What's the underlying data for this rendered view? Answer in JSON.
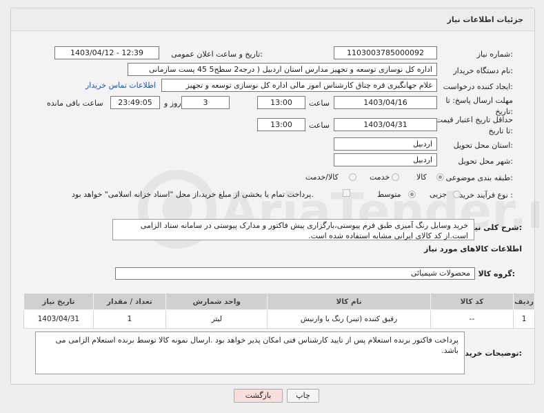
{
  "header": {
    "title": "جزئیات اطلاعات نیاز"
  },
  "fields": {
    "need_number_label": "شماره نیاز:",
    "need_number": "1103003785000092",
    "announce_label": "تاریخ و ساعت اعلان عمومی:",
    "announce_value": "1403/04/12 - 12:39",
    "buyer_org_label": "نام دستگاه خریدار:",
    "buyer_org": "اداره کل نوسازی   توسعه و تجهیز مدارس استان اردبیل ( درجه2  سطح5  45 پست سازمانی",
    "requester_label": "ایجاد کننده درخواست:",
    "requester": "غلام جهانگیری قره چناق کارشناس امور مالی اداره کل نوسازی   توسعه و تجهیز",
    "contact_link": "اطلاعات تماس خریدار",
    "deadline_label": "مهلت ارسال پاسخ: تا تاریخ:",
    "deadline_date": "1403/04/16",
    "time_label": "ساعت",
    "deadline_time": "13:00",
    "days_value": "3",
    "days_label": "روز و",
    "remaining_time": "23:49:05",
    "remaining_label": "ساعت باقی مانده",
    "validity_label": "حداقل تاریخ اعتبار قیمت: تا تاریخ:",
    "validity_date": "1403/04/31",
    "validity_time": "13:00",
    "province_label": "استان محل تحویل:",
    "province": "اردبیل",
    "city_label": "شهر محل تحویل:",
    "city": "اردبیل",
    "category_label": "طبقه بندی موضوعی:",
    "category_options": [
      "کالا",
      "خدمت",
      "کالا/خدمت"
    ],
    "purchase_label": "نوع فرآیند خرید :",
    "purchase_options": [
      "جزیی",
      "متوسط"
    ],
    "purchase_note": "پرداخت تمام یا بخشی از مبلغ خرید،از محل \"اسناد خزانه اسلامی\" خواهد بود."
  },
  "description": {
    "label": "شرح کلی نیاز:",
    "text": "خرید وسایل رنگ آمیزی طبق فرم پیوستی،بارگزاری پیش فاکتور و مدارک پیوستی در سامانه ستاد الزامی است.از کد کالای ایرانی مشابه استفاده شده است."
  },
  "goods": {
    "section_title": "اطلاعات کالاهای مورد نیاز",
    "group_label": "گروه کالا:",
    "group_value": "محصولات شیمیائی",
    "columns": [
      "ردیف",
      "کد کالا",
      "نام کالا",
      "واحد شمارش",
      "تعداد / مقدار",
      "تاریخ نیاز"
    ],
    "rows": [
      {
        "row": "1",
        "code": "--",
        "name": "رقیق کننده (تینر) رنگ یا وارنیش",
        "unit": "لیتر",
        "qty": "1",
        "date": "1403/04/31"
      }
    ]
  },
  "buyer_notes": {
    "label": "توضیحات خریدار:",
    "text": "پرداخت فاکتور برنده استعلام پس از تایید کارشناس فنی امکان پذیر خواهد بود .ارسال نمونه کالا توسط برنده استعلام الزامی می باشد."
  },
  "buttons": {
    "print": "چاپ",
    "back": "بازگشت"
  },
  "watermark": "AriaTender.neT",
  "colors": {
    "link": "#1a56b0",
    "back_button_bg": "#f9dede",
    "table_header": "#d0d0d0"
  }
}
